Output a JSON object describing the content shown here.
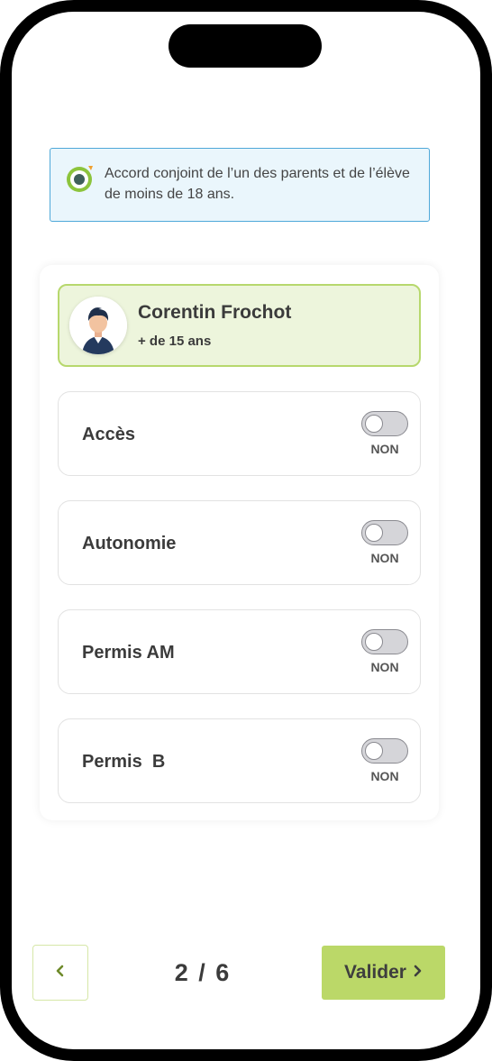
{
  "info": {
    "text": "Accord conjoint de l’un des parents et de l’élève de moins de 18 ans.",
    "icon": "target-icon"
  },
  "user": {
    "name": "Corentin Frochot",
    "age": "+ de 15 ans",
    "avatar_icon": "person-avatar"
  },
  "permissions": [
    {
      "label": "Accès",
      "state": "NON",
      "enabled": false
    },
    {
      "label": "Autonomie",
      "state": "NON",
      "enabled": false
    },
    {
      "label": "Permis AM",
      "state": "NON",
      "enabled": false
    },
    {
      "label": "Permis  B",
      "state": "NON",
      "enabled": false
    }
  ],
  "pager": {
    "text": "2 / 6"
  },
  "actions": {
    "validate_label": "Valider",
    "prev_icon": "chevron-left-icon",
    "next_icon": "chevron-right-icon"
  },
  "colors": {
    "accent": "#bbd868",
    "user_bg": "#edf5dc",
    "info_bg": "#eaf6fc",
    "info_border": "#4ea8d9"
  }
}
